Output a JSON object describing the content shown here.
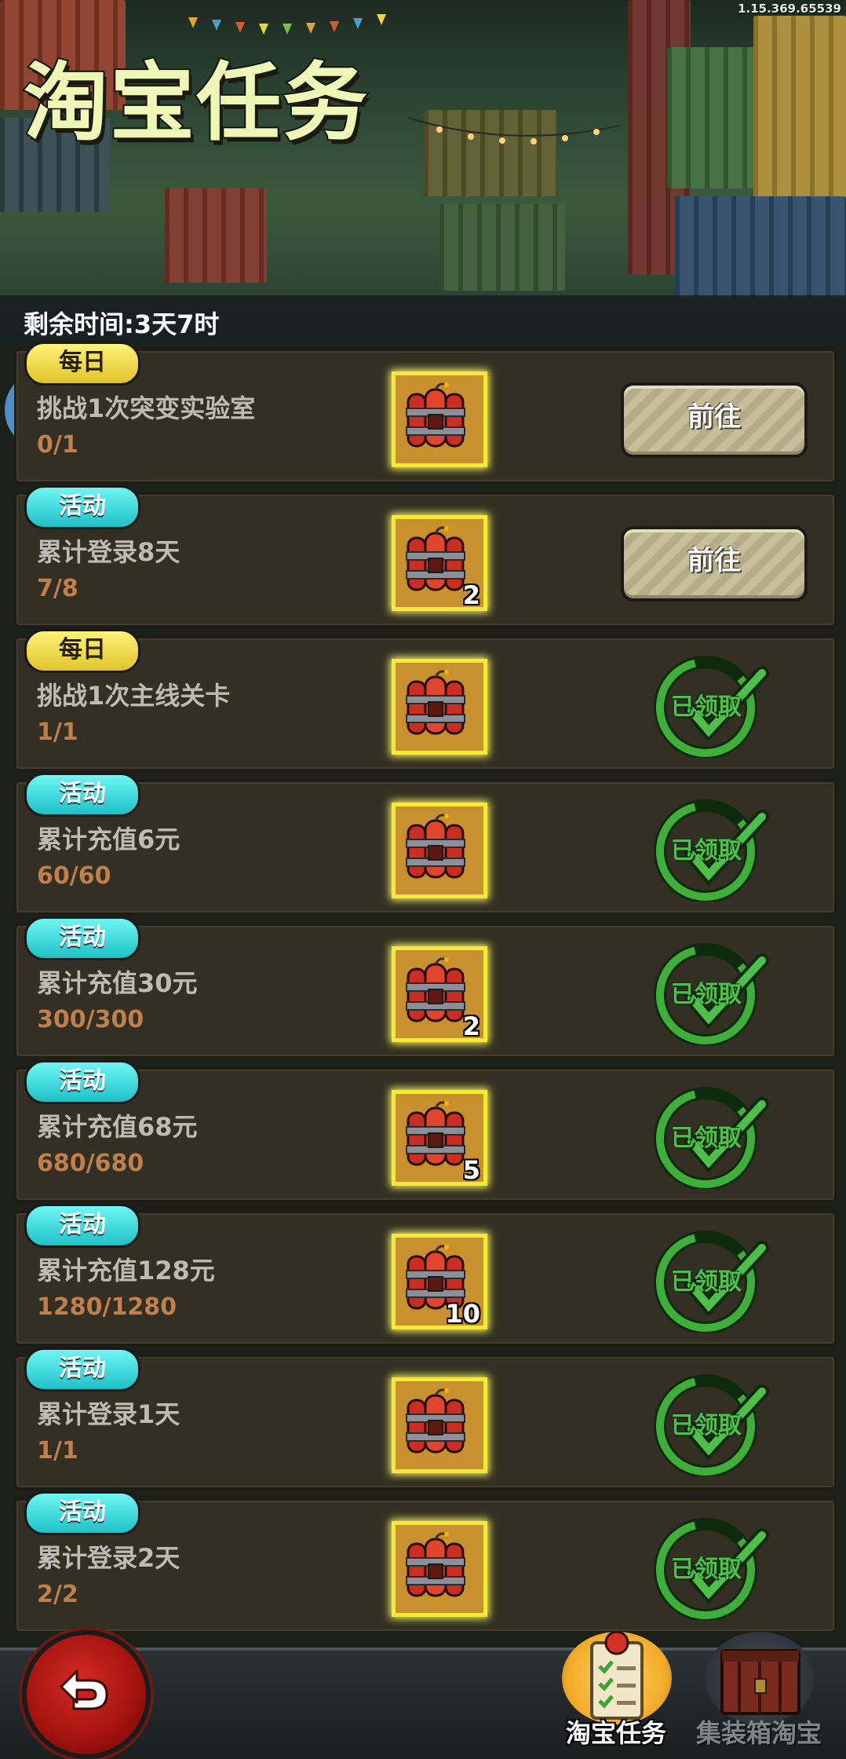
{
  "meta": {
    "version": "1.15.369.65539"
  },
  "header": {
    "title": "淘宝任务",
    "timer": "剩余时间:3天7时"
  },
  "tasks": [
    {
      "tag": "每日",
      "tag_type": "daily",
      "name": "挑战1次突变实验室",
      "progress": "0/1",
      "reward_count": "",
      "action": "前往",
      "claimed": false
    },
    {
      "tag": "活动",
      "tag_type": "event",
      "name": "累计登录8天",
      "progress": "7/8",
      "reward_count": "2",
      "action": "前往",
      "claimed": false
    },
    {
      "tag": "每日",
      "tag_type": "daily",
      "name": "挑战1次主线关卡",
      "progress": "1/1",
      "reward_count": "",
      "action": "已领取",
      "claimed": true
    },
    {
      "tag": "活动",
      "tag_type": "event",
      "name": "累计充值6元",
      "progress": "60/60",
      "reward_count": "",
      "action": "已领取",
      "claimed": true
    },
    {
      "tag": "活动",
      "tag_type": "event",
      "name": "累计充值30元",
      "progress": "300/300",
      "reward_count": "2",
      "action": "已领取",
      "claimed": true
    },
    {
      "tag": "活动",
      "tag_type": "event",
      "name": "累计充值68元",
      "progress": "680/680",
      "reward_count": "5",
      "action": "已领取",
      "claimed": true
    },
    {
      "tag": "活动",
      "tag_type": "event",
      "name": "累计充值128元",
      "progress": "1280/1280",
      "reward_count": "10",
      "action": "已领取",
      "claimed": true
    },
    {
      "tag": "活动",
      "tag_type": "event",
      "name": "累计登录1天",
      "progress": "1/1",
      "reward_count": "",
      "action": "已领取",
      "claimed": true
    },
    {
      "tag": "活动",
      "tag_type": "event",
      "name": "累计登录2天",
      "progress": "2/2",
      "reward_count": "",
      "action": "已领取",
      "claimed": true
    }
  ],
  "nav": {
    "back_icon": "back-arrow-icon",
    "tabs": [
      {
        "label": "淘宝任务",
        "icon": "task-scroll-icon",
        "active": true
      },
      {
        "label": "集装箱淘宝",
        "icon": "container-crate-icon",
        "active": false
      }
    ]
  },
  "colors": {
    "title": "#eef7b5",
    "daily_tag": "#f0d84a",
    "event_tag": "#2fd6d8",
    "progress": "#c0804e",
    "claimed": "#4fbf4c",
    "reward_border": "#f6e93a"
  }
}
